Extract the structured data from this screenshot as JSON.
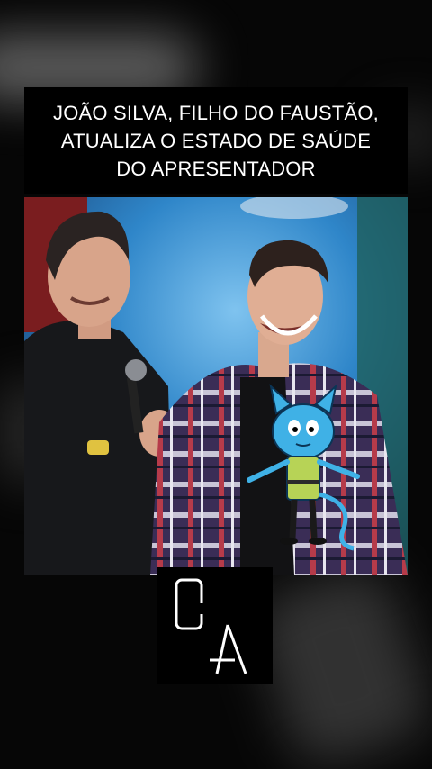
{
  "headline": {
    "line1": "JOÃO SILVA, FILHO DO FAUSTÃO,",
    "line2": "ATUALIZA O ESTADO DE SAÚDE",
    "line3": "DO APRESENTADOR"
  },
  "photo": {
    "subjects": [
      "older-man-icon",
      "young-man-icon",
      "cartoon-cat-icon"
    ]
  },
  "brand": {
    "logo": "oa-logo"
  },
  "colors": {
    "background": "#050505",
    "headline_bg": "#000000",
    "headline_text": "#ffffff",
    "studio_blue": "#2a6fb0"
  }
}
